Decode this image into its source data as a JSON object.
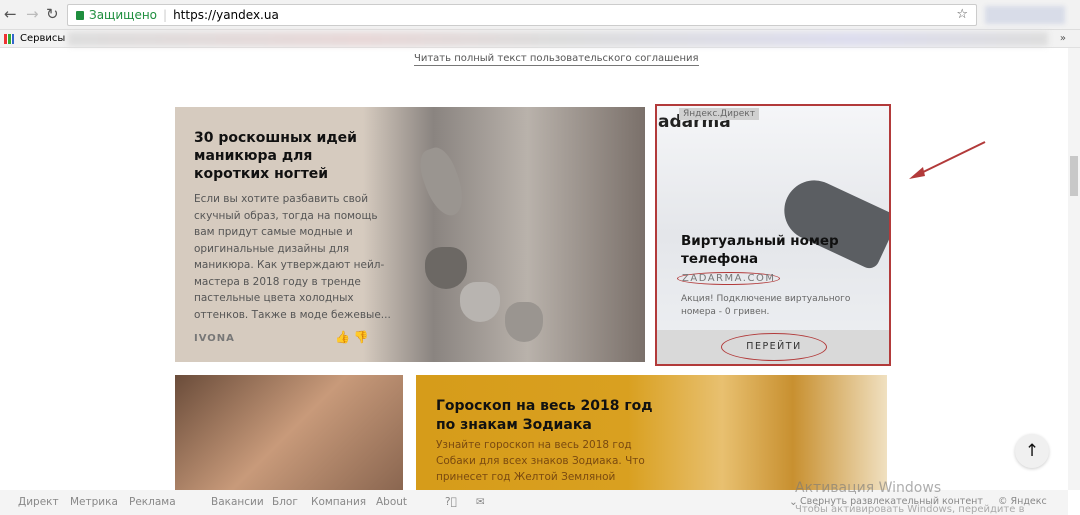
{
  "browser": {
    "secure_label": "Защищено",
    "url": "https://yandex.ua",
    "bookmarks_label": "Сервисы"
  },
  "page": {
    "agreement_link": "Читать полный текст пользовательского соглашения",
    "card1": {
      "title": "30 роскошных идей маникюра для коротких ногтей",
      "text": "Если вы хотите разбавить свой скучный образ, тогда на помощь вам придут самые модные и оригинальные дизайны для маникюра. Как утверждают нейл-мастера в 2018 году в тренде пастельные цвета холодных оттенков. Также в моде бежевые...",
      "source": "IVONA"
    },
    "ad": {
      "logo": "adarma",
      "tag": "Яндекс.Директ",
      "title": "Виртуальный номер телефона",
      "domain": "ZADARMA.COM",
      "text": "Акция! Подключение виртуального номера - 0 гривен.",
      "button": "ПЕРЕЙТИ"
    },
    "card4": {
      "title": "Гороскоп на весь 2018 год по знакам Зодиака",
      "text": "Узнайте гороскоп на весь 2018 год Собаки для всех знаков Зодиака. Что принесет год Желтой Земляной"
    }
  },
  "footer": {
    "links": [
      "Директ",
      "Метрика",
      "Реклама",
      "Вакансии",
      "Блог",
      "Компания",
      "About"
    ],
    "collapse": "Свернуть развлекательный контент",
    "copyright": "© Яндекс"
  },
  "watermark": {
    "line1": "Активация Windows",
    "line2": "Чтобы активировать Windows, перейдите в"
  },
  "colors": {
    "annotation": "#b23a3a",
    "secure": "#1e8e3e",
    "horoscope_bg": "#d69c1a"
  }
}
